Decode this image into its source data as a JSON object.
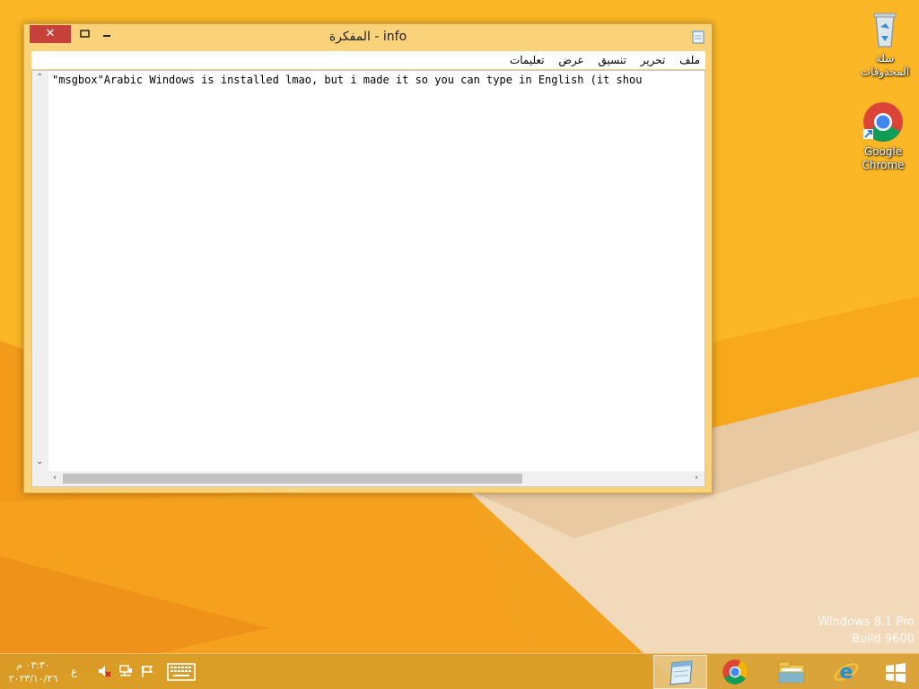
{
  "desktop": {
    "icons": [
      {
        "label": "سلة المحذوفات",
        "icon": "recycle-bin-icon"
      },
      {
        "label": "Google Chrome",
        "icon": "chrome-icon"
      }
    ],
    "watermark": {
      "line1": "Windows 8.1 Pro",
      "line2": "Build 9600"
    }
  },
  "window": {
    "title": "info - المفكرة",
    "close_glyph": "✕",
    "menu": [
      "ملف",
      "تحرير",
      "تنسيق",
      "عرض",
      "تعليمات"
    ],
    "text": "\"msgbox\"Arabic Windows is installed lmao, but i made it so you can type in English (it shou"
  },
  "taskbar": {
    "clock_time": "٠٣:٣٠ م",
    "clock_date": "٢٠٢٣/١٠/٢٦",
    "language": "ع",
    "pinned": [
      "notepad-icon",
      "chrome-icon",
      "file-explorer-icon",
      "internet-explorer-icon",
      "windows-start-icon"
    ]
  },
  "colors": {
    "wallpaper_orange": "#f6a61a",
    "window_frame": "#f9d27a",
    "close_button": "#c7413b"
  }
}
